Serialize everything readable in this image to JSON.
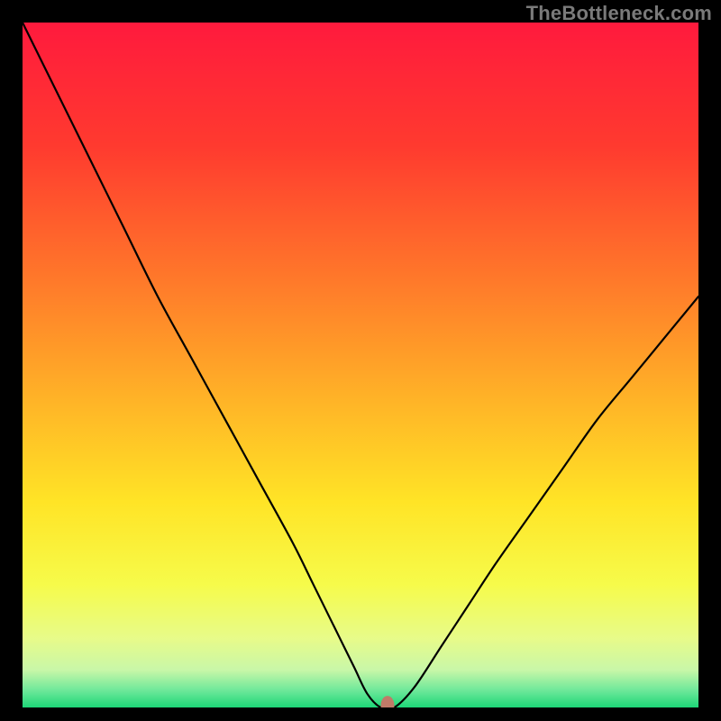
{
  "watermark": "TheBottleneck.com",
  "chart_data": {
    "type": "line",
    "title": "",
    "xlabel": "",
    "ylabel": "",
    "xlim": [
      0,
      100
    ],
    "ylim": [
      0,
      100
    ],
    "grid": false,
    "legend": false,
    "background_gradient": {
      "stops": [
        {
          "offset": 0.0,
          "color": "#ff1a3d"
        },
        {
          "offset": 0.18,
          "color": "#ff3a2f"
        },
        {
          "offset": 0.38,
          "color": "#ff7a2a"
        },
        {
          "offset": 0.55,
          "color": "#ffb327"
        },
        {
          "offset": 0.7,
          "color": "#ffe426"
        },
        {
          "offset": 0.82,
          "color": "#f6fb4a"
        },
        {
          "offset": 0.9,
          "color": "#e7fb8a"
        },
        {
          "offset": 0.945,
          "color": "#c9f7a8"
        },
        {
          "offset": 0.975,
          "color": "#6ee89a"
        },
        {
          "offset": 1.0,
          "color": "#1dd677"
        }
      ]
    },
    "series": [
      {
        "name": "bottleneck-curve",
        "color": "#000000",
        "width": 2.2,
        "x": [
          0,
          5,
          10,
          15,
          20,
          25,
          30,
          35,
          40,
          43,
          46,
          49,
          51,
          53,
          55,
          58,
          62,
          66,
          70,
          75,
          80,
          85,
          90,
          95,
          100
        ],
        "y": [
          100,
          90,
          80,
          70,
          60,
          51,
          42,
          33,
          24,
          18,
          12,
          6,
          2,
          0,
          0,
          3,
          9,
          15,
          21,
          28,
          35,
          42,
          48,
          54,
          60
        ]
      }
    ],
    "marker": {
      "name": "optimal-point",
      "x": 54,
      "y": 0,
      "rx": 1.0,
      "ry": 1.4,
      "color": "#c07a68"
    }
  }
}
